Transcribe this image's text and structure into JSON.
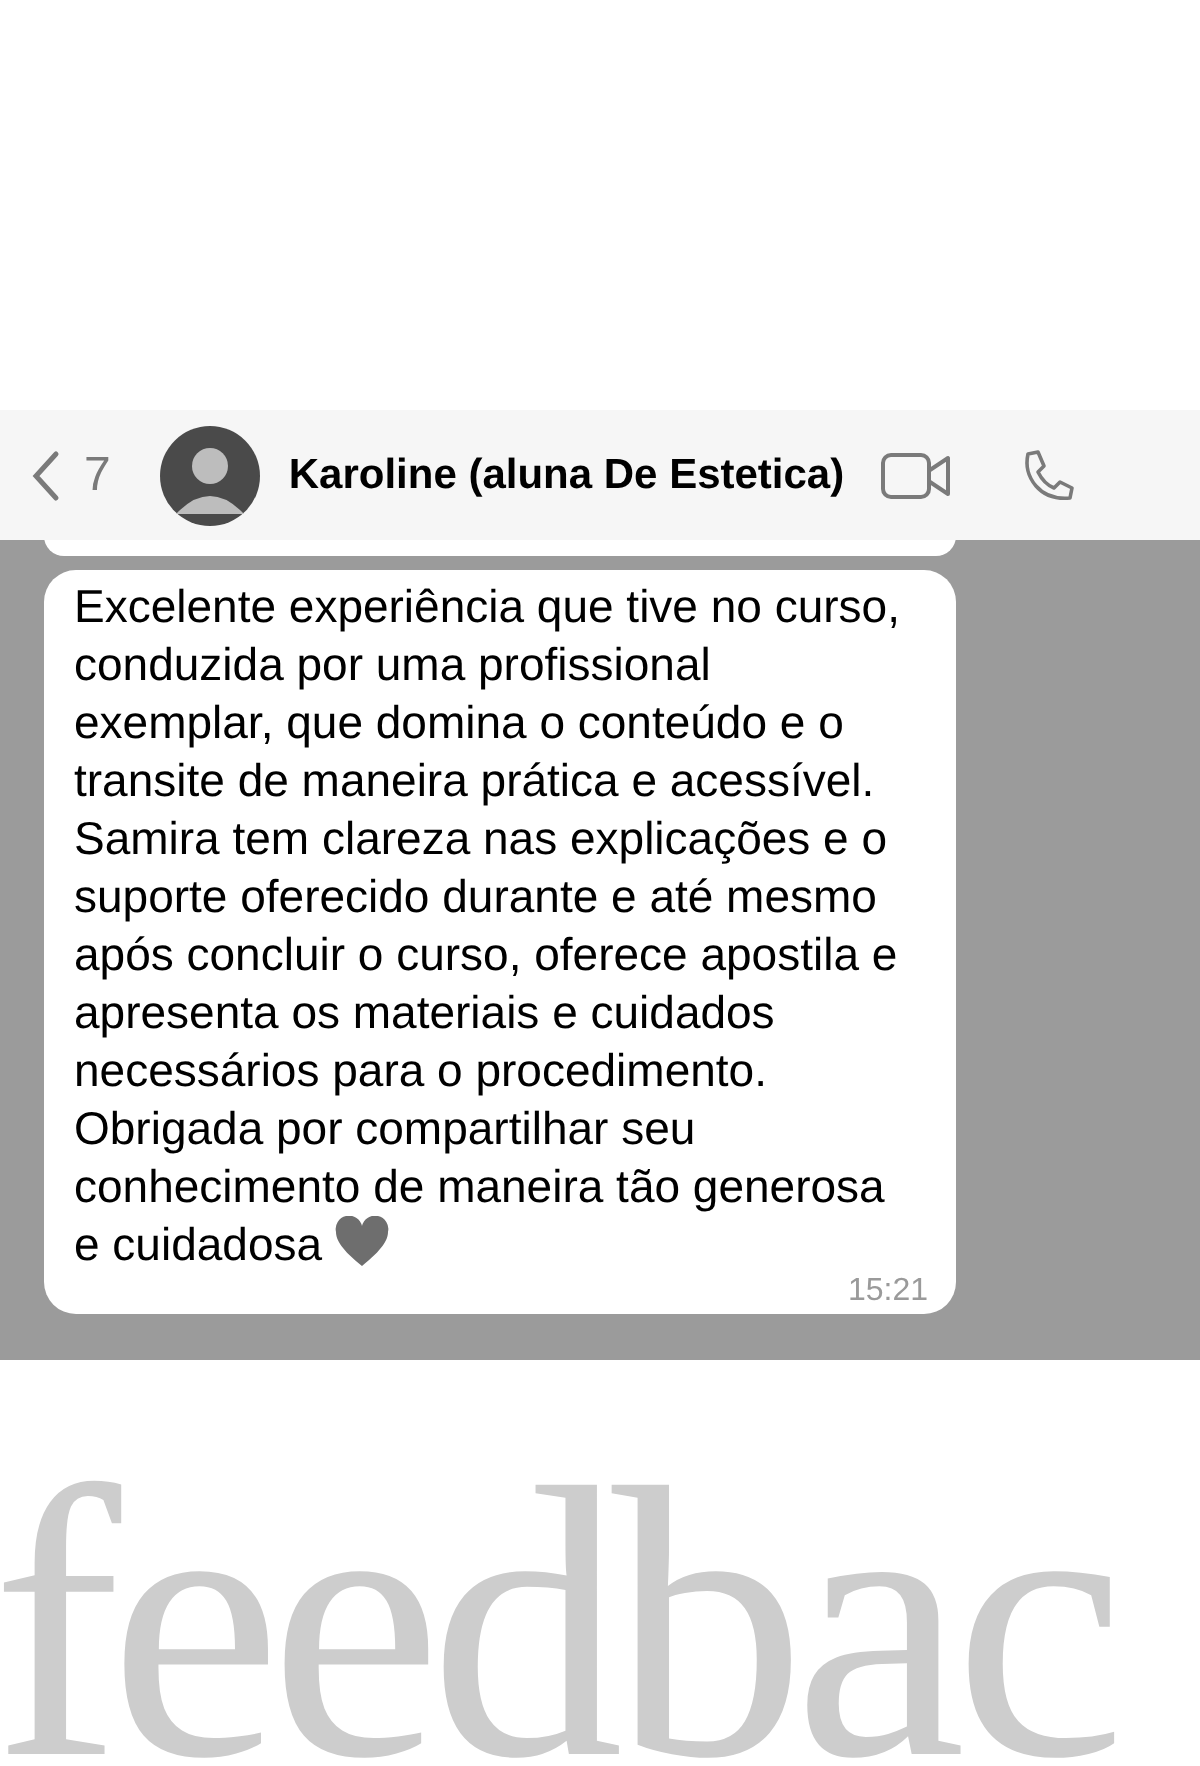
{
  "header": {
    "back_count": "7",
    "contact_name": "Karoline (aluna De Estetica)"
  },
  "messages": [
    {
      "text": "Excelente experiência que tive no curso,\nconduzida por uma profissional\nexemplar, que domina o conteúdo e o\ntransite de maneira prática e acessível.\nSamira tem clareza nas explicações e o\nsuporte oferecido durante e até mesmo\napós concluir o curso, oferece apostila e\napresenta os materiais e cuidados\nnecessários para o procedimento.\nObrigada por compartilhar seu\nconhecimento de maneira tão generosa\ne cuidadosa",
      "time": "15:21"
    }
  ],
  "banner": {
    "text": "feedbac"
  }
}
